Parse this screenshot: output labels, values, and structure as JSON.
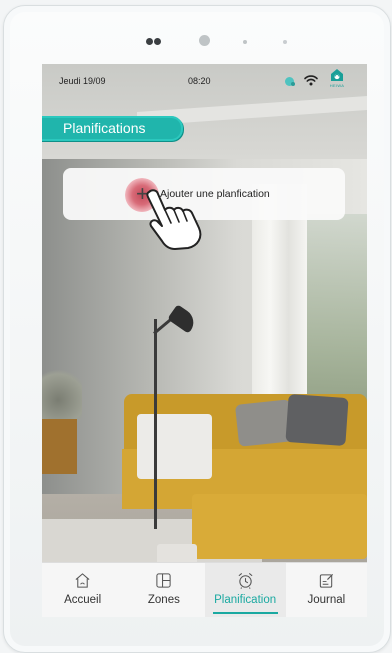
{
  "statusbar": {
    "date": "Jeudi 19/09",
    "time": "08:20",
    "brand": "HEIWA"
  },
  "page": {
    "title": "Planifications"
  },
  "add_schedule": {
    "label": "Ajouter une planfication"
  },
  "nav": {
    "items": [
      {
        "label": "Accueil",
        "icon": "home-icon"
      },
      {
        "label": "Zones",
        "icon": "zones-icon"
      },
      {
        "label": "Planification",
        "icon": "alarm-clock-icon",
        "active": true
      },
      {
        "label": "Journal",
        "icon": "journal-icon"
      }
    ]
  },
  "colors": {
    "accent": "#1aa9a1",
    "ripple": "#c34a5a"
  }
}
